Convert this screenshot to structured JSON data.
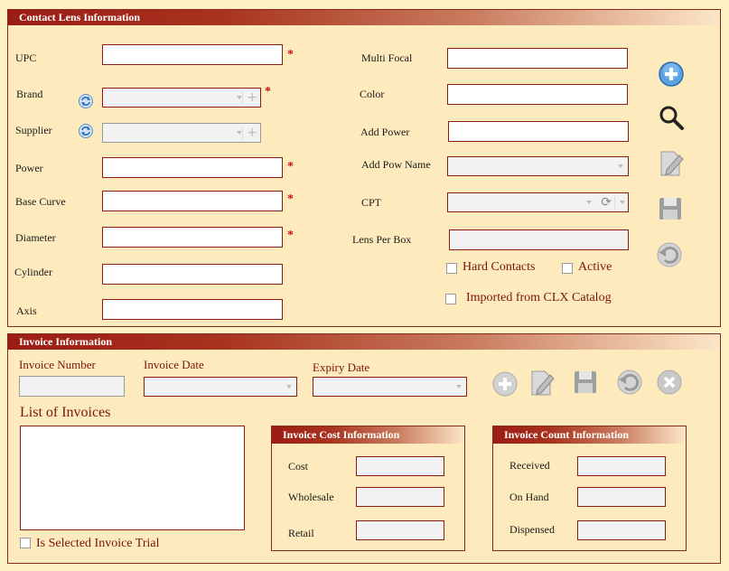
{
  "contact_lens": {
    "header": "Contact Lens Information",
    "upc_label": "UPC",
    "brand_label": "Brand",
    "supplier_label": "Supplier",
    "power_label": "Power",
    "base_curve_label": "Base Curve",
    "diameter_label": "Diameter",
    "cylinder_label": "Cylinder",
    "axis_label": "Axis",
    "multi_focal_label": "Multi Focal",
    "color_label": "Color",
    "add_power_label": "Add Power",
    "add_pow_name_label": "Add Pow Name",
    "cpt_label": "CPT",
    "lens_per_box_label": "Lens Per Box",
    "hard_contacts_label": "Hard Contacts",
    "active_label": "Active",
    "imported_label": "Imported from CLX Catalog",
    "required_mark": "*",
    "values": {
      "upc": "",
      "brand": "",
      "supplier": "",
      "power": "",
      "base_curve": "",
      "diameter": "",
      "cylinder": "",
      "axis": "",
      "multi_focal": "",
      "color": "",
      "add_power": "",
      "add_pow_name": "",
      "cpt": "",
      "lens_per_box": ""
    },
    "checkboxes": {
      "hard_contacts": false,
      "active": false,
      "imported": false
    }
  },
  "invoice": {
    "header": "Invoice Information",
    "invoice_number_label": "Invoice Number",
    "invoice_date_label": "Invoice Date",
    "expiry_date_label": "Expiry Date",
    "list_label": "List of Invoices",
    "is_selected_trial_label": "Is Selected Invoice Trial",
    "cost_panel": {
      "header": "Invoice Cost Information",
      "cost_label": "Cost",
      "wholesale_label": "Wholesale",
      "retail_label": "Retail"
    },
    "count_panel": {
      "header": "Invoice Count Information",
      "received_label": "Received",
      "on_hand_label": "On Hand",
      "dispensed_label": "Dispensed"
    },
    "values": {
      "invoice_number": "",
      "invoice_date": "",
      "expiry_date": ""
    },
    "checkboxes": {
      "is_selected_trial": false
    }
  },
  "icons": [
    "add-icon",
    "search-icon",
    "edit-icon",
    "save-icon",
    "undo-icon",
    "refresh-icon",
    "cancel-icon"
  ],
  "colors": {
    "background": "#fdf0c4",
    "border": "#8b1c14",
    "header_start": "#9b1c14",
    "required": "#cc1111",
    "label_red": "#7a1410"
  }
}
